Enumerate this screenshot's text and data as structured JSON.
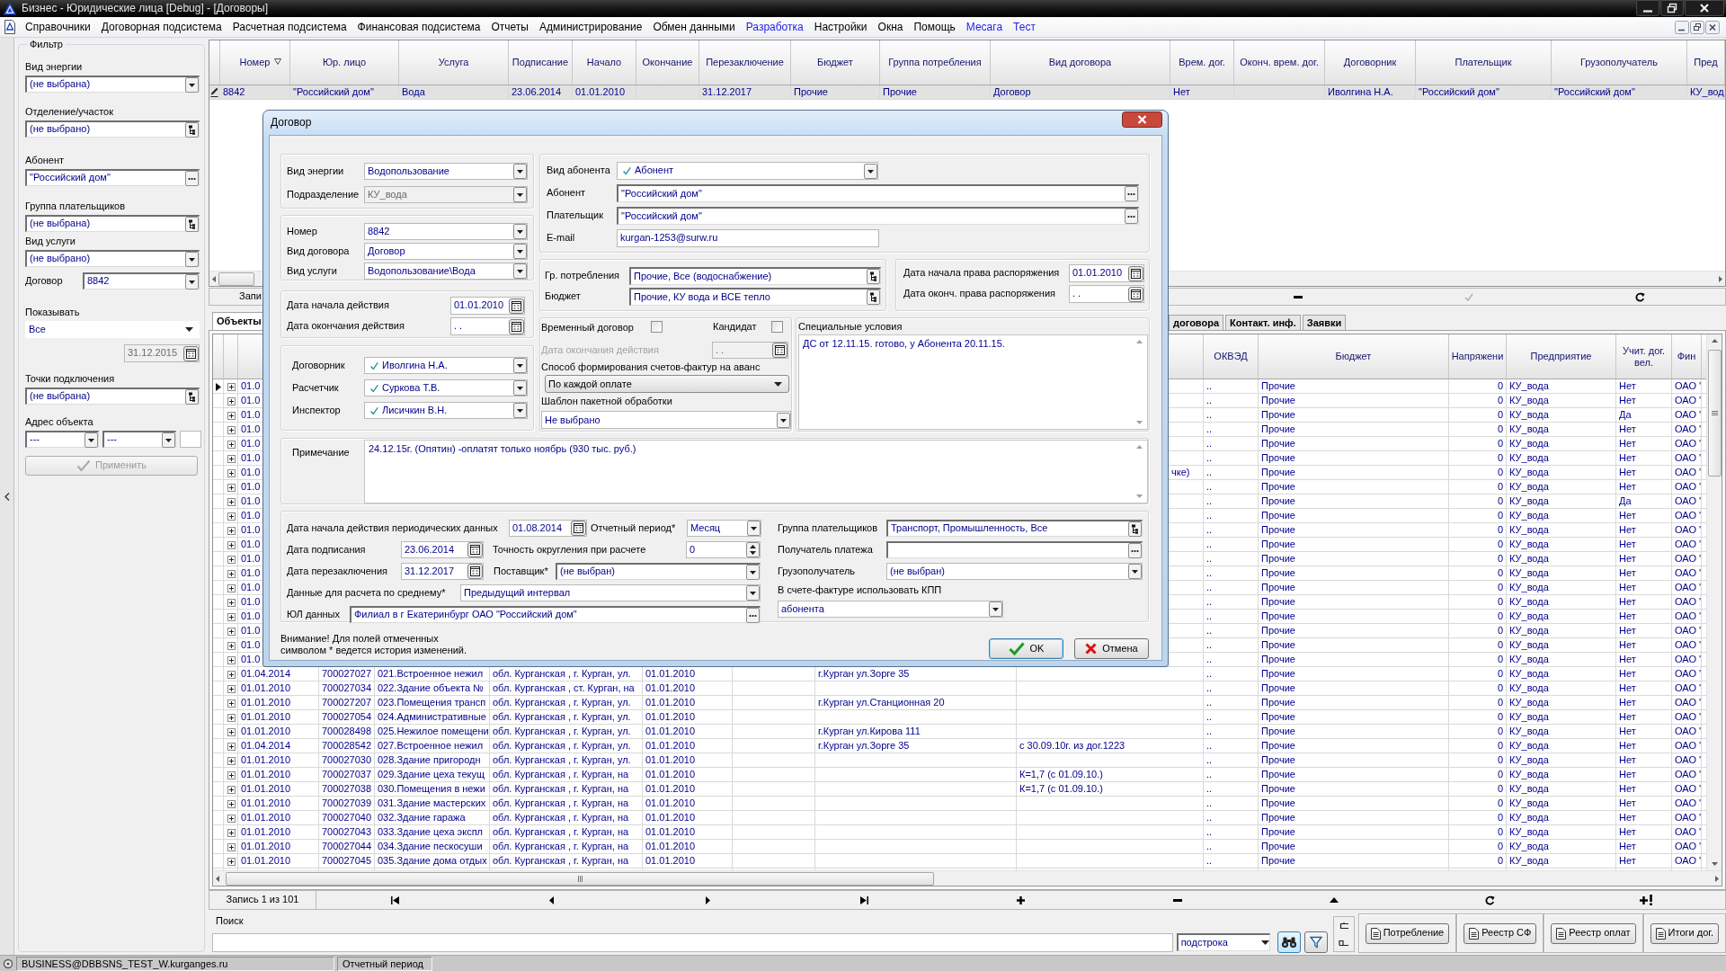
{
  "window": {
    "title": "Бизнес - Юридические лица [Debug] - [Договоры]"
  },
  "menu": [
    {
      "label": "Справочники",
      "color": "#000000"
    },
    {
      "label": "Договорная подсистема",
      "color": "#000000"
    },
    {
      "label": "Расчетная подсистема",
      "color": "#000000"
    },
    {
      "label": "Финансовая подсистема",
      "color": "#000000"
    },
    {
      "label": "Отчеты",
      "color": "#000000"
    },
    {
      "label": "Администрирование",
      "color": "#000000"
    },
    {
      "label": "Обмен данными",
      "color": "#000000"
    },
    {
      "label": "Разработка",
      "color": "#1f1fe6"
    },
    {
      "label": "Настройки",
      "color": "#000000"
    },
    {
      "label": "Окна",
      "color": "#000000"
    },
    {
      "label": "Помощь",
      "color": "#000000"
    },
    {
      "label": "Месага",
      "color": "#1f1fe6"
    },
    {
      "label": "Тест",
      "color": "#1f1fe6"
    }
  ],
  "filter": {
    "title": "Фильтр",
    "fields": [
      {
        "kind": "combo",
        "label": "Вид энергии",
        "value": "(не выбрана)"
      },
      {
        "kind": "tree",
        "label": "Отделение/участок",
        "value": "(не выбрано)"
      },
      {
        "kind": "lookup",
        "label": "Абонент",
        "value": "\"Российский дом\""
      },
      {
        "kind": "tree",
        "label": "Группа плательщиков",
        "value": "(не выбрана)"
      },
      {
        "kind": "combo",
        "label": "Вид услуги",
        "value": "(не выбрано)"
      },
      {
        "kind": "inline_combo",
        "label": "Договор",
        "value": "8842"
      },
      {
        "kind": "flat_combo",
        "label": "Показывать",
        "value": "Все"
      },
      {
        "kind": "date",
        "value": "31.12.2015",
        "disabled": true
      },
      {
        "kind": "tree",
        "label": "Точки подключения",
        "value": "(не выбрана)"
      },
      {
        "kind": "address",
        "label": "Адрес объекта",
        "values": [
          "---",
          "---"
        ]
      }
    ],
    "apply_button": {
      "label": "Применить",
      "disabled": true
    }
  },
  "top_grid": {
    "columns": [
      {
        "label": "Номер",
        "sorted": true
      },
      {
        "label": "Юр. лицо",
        "sorted": false
      },
      {
        "label": "Услуга",
        "sorted": false
      },
      {
        "label": "Подписание",
        "sorted": false
      },
      {
        "label": "Начало",
        "sorted": false
      },
      {
        "label": "Окончание",
        "sorted": false
      },
      {
        "label": "Перезаключение",
        "sorted": false
      },
      {
        "label": "Бюджет",
        "sorted": false
      },
      {
        "label": "Группа потребления",
        "sorted": false
      },
      {
        "label": "Вид договора",
        "sorted": false
      },
      {
        "label": "Врем. дог.",
        "sorted": false
      },
      {
        "label": "Оконч. врем. дог.",
        "sorted": false
      },
      {
        "label": "Договорник",
        "sorted": false
      },
      {
        "label": "Плательщик",
        "sorted": false
      },
      {
        "label": "Грузополучатель",
        "sorted": false
      },
      {
        "label": "Пред",
        "sorted": false
      }
    ],
    "rows": [
      {
        "selected": true,
        "editing": true,
        "cells": {
          "number": "8842",
          "legal_entity": "\"Российский дом\"",
          "service": "Вода",
          "signed": "23.06.2014",
          "start": "01.01.2010",
          "renewal": "31.12.2017",
          "budget": "Прочие",
          "consumption_group": "Прочие",
          "contract_type": "Договор",
          "temporary": "Нет",
          "contractor": "Иволгина Н.А.",
          "payer": "\"Российский дом\"",
          "consignee": "\"Российский дом\"",
          "column_16": "КУ_вод"
        }
      }
    ],
    "navigator": {
      "record": "Запи"
    }
  },
  "tabs": [
    {
      "label": "Объекты",
      "selected": true
    },
    {
      "label": "договора",
      "selected": false
    },
    {
      "label": "Контакт. инф.",
      "selected": false
    },
    {
      "label": "Заявки",
      "selected": false
    }
  ],
  "bottom_grid": {
    "columns": [
      {
        "label": "ОКВЭД"
      },
      {
        "label": "Бюджет"
      },
      {
        "label": "Напряжени"
      },
      {
        "label": "Предприятие"
      },
      {
        "label": "Учит. дог. вел."
      },
      {
        "label": "Фин"
      }
    ],
    "rows": [
      {
        "selected": true,
        "expanded": false,
        "cells": {
          "column_1": "01.0",
          "okved": "..",
          "budget": "Прочие",
          "voltage": "0",
          "enterprise": "КУ_вода",
          "accounted": "Нет",
          "fin": "ОАО '"
        }
      },
      {
        "selected": false,
        "expanded": false,
        "cells": {
          "column_1": "01.0",
          "okved": "..",
          "budget": "Прочие",
          "voltage": "0",
          "enterprise": "КУ_вода",
          "accounted": "Нет",
          "fin": "ОАО '"
        }
      },
      {
        "selected": false,
        "expanded": false,
        "cells": {
          "column_1": "01.0",
          "okved": "..",
          "budget": "Прочие",
          "voltage": "0",
          "enterprise": "КУ_вода",
          "accounted": "Да",
          "fin": "ОАО '"
        }
      },
      {
        "selected": false,
        "expanded": false,
        "cells": {
          "column_1": "01.0",
          "okved": "..",
          "budget": "Прочие",
          "voltage": "0",
          "enterprise": "КУ_вода",
          "accounted": "Нет",
          "fin": "ОАО '"
        }
      },
      {
        "selected": false,
        "expanded": false,
        "cells": {
          "column_1": "01.0",
          "okved": "..",
          "budget": "Прочие",
          "voltage": "0",
          "enterprise": "КУ_вода",
          "accounted": "Нет",
          "fin": "ОАО '"
        }
      },
      {
        "selected": false,
        "expanded": false,
        "cells": {
          "column_1": "01.0",
          "okved": "..",
          "budget": "Прочие",
          "voltage": "0",
          "enterprise": "КУ_вода",
          "accounted": "Нет",
          "fin": "ОАО '"
        }
      },
      {
        "selected": false,
        "expanded": false,
        "cells": {
          "column_1": "01.0",
          "column_8": "чке)",
          "okved": "..",
          "budget": "Прочие",
          "voltage": "0",
          "enterprise": "КУ_вода",
          "accounted": "Нет",
          "fin": "ОАО '"
        }
      },
      {
        "selected": false,
        "expanded": false,
        "cells": {
          "column_1": "01.0",
          "okved": "..",
          "budget": "Прочие",
          "voltage": "0",
          "enterprise": "КУ_вода",
          "accounted": "Нет",
          "fin": "ОАО '"
        }
      },
      {
        "selected": false,
        "expanded": false,
        "cells": {
          "column_1": "01.0",
          "okved": "..",
          "budget": "Прочие",
          "voltage": "0",
          "enterprise": "КУ_вода",
          "accounted": "Да",
          "fin": "ОАО '"
        }
      },
      {
        "selected": false,
        "expanded": false,
        "cells": {
          "column_1": "01.0",
          "okved": "..",
          "budget": "Прочие",
          "voltage": "0",
          "enterprise": "КУ_вода",
          "accounted": "Нет",
          "fin": "ОАО '"
        }
      },
      {
        "selected": false,
        "expanded": false,
        "cells": {
          "column_1": "01.0",
          "okved": "..",
          "budget": "Прочие",
          "voltage": "0",
          "enterprise": "КУ_вода",
          "accounted": "Нет",
          "fin": "ОАО '"
        }
      },
      {
        "selected": false,
        "expanded": false,
        "cells": {
          "column_1": "01.0",
          "okved": "..",
          "budget": "Прочие",
          "voltage": "0",
          "enterprise": "КУ_вода",
          "accounted": "Нет",
          "fin": "ОАО '"
        }
      },
      {
        "selected": false,
        "expanded": false,
        "cells": {
          "column_1": "01.0",
          "okved": "..",
          "budget": "Прочие",
          "voltage": "0",
          "enterprise": "КУ_вода",
          "accounted": "Нет",
          "fin": "ОАО '"
        }
      },
      {
        "selected": false,
        "expanded": false,
        "cells": {
          "column_1": "01.0",
          "okved": "..",
          "budget": "Прочие",
          "voltage": "0",
          "enterprise": "КУ_вода",
          "accounted": "Нет",
          "fin": "ОАО '"
        }
      },
      {
        "selected": false,
        "expanded": false,
        "cells": {
          "column_1": "01.0",
          "okved": "..",
          "budget": "Прочие",
          "voltage": "0",
          "enterprise": "КУ_вода",
          "accounted": "Нет",
          "fin": "ОАО '"
        }
      },
      {
        "selected": false,
        "expanded": false,
        "cells": {
          "column_1": "01.0",
          "okved": "..",
          "budget": "Прочие",
          "voltage": "0",
          "enterprise": "КУ_вода",
          "accounted": "Нет",
          "fin": "ОАО '"
        }
      },
      {
        "selected": false,
        "expanded": false,
        "cells": {
          "column_1": "01.0",
          "okved": "..",
          "budget": "Прочие",
          "voltage": "0",
          "enterprise": "КУ_вода",
          "accounted": "Нет",
          "fin": "ОАО '"
        }
      },
      {
        "selected": false,
        "expanded": false,
        "cells": {
          "column_1": "01.0",
          "okved": "..",
          "budget": "Прочие",
          "voltage": "0",
          "enterprise": "КУ_вода",
          "accounted": "Нет",
          "fin": "ОАО '"
        }
      },
      {
        "selected": false,
        "expanded": false,
        "cells": {
          "column_1": "01.0",
          "okved": "..",
          "budget": "Прочие",
          "voltage": "0",
          "enterprise": "КУ_вода",
          "accounted": "Нет",
          "fin": "ОАО '"
        }
      },
      {
        "selected": false,
        "expanded": false,
        "cells": {
          "column_1": "01.0",
          "okved": "..",
          "budget": "Прочие",
          "voltage": "0",
          "enterprise": "КУ_вода",
          "accounted": "Нет",
          "fin": "ОАО '"
        }
      },
      {
        "selected": false,
        "expanded": false,
        "cells": {
          "column_1": "01.04.2014",
          "column_2": "700027027",
          "column_3": "021.Встроенное нежил",
          "column_4": "обл. Курганская , г. Курган, ул.",
          "column_5": "01.01.2010",
          "column_7": "г.Курган ул.Зорге 35",
          "okved": "..",
          "budget": "Прочие",
          "voltage": "0",
          "enterprise": "КУ_вода",
          "accounted": "Нет",
          "fin": "ОАО '"
        }
      },
      {
        "selected": false,
        "expanded": false,
        "cells": {
          "column_1": "01.01.2010",
          "column_2": "700027034",
          "column_3": "022.Здание объекта №",
          "column_4": "обл. Курганская , ст. Курган, на",
          "column_5": "01.01.2010",
          "okved": "..",
          "budget": "Прочие",
          "voltage": "0",
          "enterprise": "КУ_вода",
          "accounted": "Нет",
          "fin": "ОАО '"
        }
      },
      {
        "selected": false,
        "expanded": false,
        "cells": {
          "column_1": "01.01.2010",
          "column_2": "700027207",
          "column_3": "023.Помещения трансп",
          "column_4": "обл. Курганская , г. Курган, ул.",
          "column_5": "01.01.2010",
          "column_7": "г.Курган ул.Станционная 20",
          "okved": "..",
          "budget": "Прочие",
          "voltage": "0",
          "enterprise": "КУ_вода",
          "accounted": "Нет",
          "fin": "ОАО '"
        }
      },
      {
        "selected": false,
        "expanded": false,
        "cells": {
          "column_1": "01.01.2010",
          "column_2": "700027054",
          "column_3": "024.Административные",
          "column_4": "обл. Курганская , г. Курган, ул.",
          "column_5": "01.01.2010",
          "okved": "..",
          "budget": "Прочие",
          "voltage": "0",
          "enterprise": "КУ_вода",
          "accounted": "Нет",
          "fin": "ОАО '"
        }
      },
      {
        "selected": false,
        "expanded": false,
        "cells": {
          "column_1": "01.01.2010",
          "column_2": "700028498",
          "column_3": "025.Нежилое помещени",
          "column_4": "обл. Курганская , г. Курган, ул.",
          "column_5": "01.01.2010",
          "column_7": "г.Курган ул.Кирова 111",
          "okved": "..",
          "budget": "Прочие",
          "voltage": "0",
          "enterprise": "КУ_вода",
          "accounted": "Нет",
          "fin": "ОАО '"
        }
      },
      {
        "selected": false,
        "expanded": false,
        "cells": {
          "column_1": "01.04.2014",
          "column_2": "700028542",
          "column_3": "027.Встроенное нежил",
          "column_4": "обл. Курганская , г. Курган, ул.",
          "column_5": "01.01.2010",
          "column_7": "г.Курган ул.Зорге 35",
          "column_8": "с 30.09.10г. из дог.1223",
          "okved": "..",
          "budget": "Прочие",
          "voltage": "0",
          "enterprise": "КУ_вода",
          "accounted": "Нет",
          "fin": "ОАО '"
        }
      },
      {
        "selected": false,
        "expanded": false,
        "cells": {
          "column_1": "01.01.2010",
          "column_2": "700027030",
          "column_3": "028.Здание пригородн",
          "column_4": "обл. Курганская , г. Курган, ул.",
          "column_5": "01.01.2010",
          "okved": "..",
          "budget": "Прочие",
          "voltage": "0",
          "enterprise": "КУ_вода",
          "accounted": "Нет",
          "fin": "ОАО '"
        }
      },
      {
        "selected": false,
        "expanded": false,
        "cells": {
          "column_1": "01.01.2010",
          "column_2": "700027037",
          "column_3": "029.Здание цеха текущ",
          "column_4": "обл. Курганская , г. Курган, на",
          "column_5": "01.01.2010",
          "column_8": "К=1,7 (с 01.09.10.)",
          "okved": "..",
          "budget": "Прочие",
          "voltage": "0",
          "enterprise": "КУ_вода",
          "accounted": "Нет",
          "fin": "ОАО '"
        }
      },
      {
        "selected": false,
        "expanded": false,
        "cells": {
          "column_1": "01.01.2010",
          "column_2": "700027038",
          "column_3": "030.Помещения в нежи",
          "column_4": "обл. Курганская , г. Курган, на",
          "column_5": "01.01.2010",
          "column_8": "К=1,7 (с 01.09.10.)",
          "okved": "..",
          "budget": "Прочие",
          "voltage": "0",
          "enterprise": "КУ_вода",
          "accounted": "Нет",
          "fin": "ОАО '"
        }
      },
      {
        "selected": false,
        "expanded": false,
        "cells": {
          "column_1": "01.01.2010",
          "column_2": "700027039",
          "column_3": "031.Здание мастерских",
          "column_4": "обл. Курганская , г. Курган, на",
          "column_5": "01.01.2010",
          "okved": "..",
          "budget": "Прочие",
          "voltage": "0",
          "enterprise": "КУ_вода",
          "accounted": "Нет",
          "fin": "ОАО '"
        }
      },
      {
        "selected": false,
        "expanded": false,
        "cells": {
          "column_1": "01.01.2010",
          "column_2": "700027040",
          "column_3": "032.Здание гаража",
          "column_4": "обл. Курганская , г. Курган, на",
          "column_5": "01.01.2010",
          "okved": "..",
          "budget": "Прочие",
          "voltage": "0",
          "enterprise": "КУ_вода",
          "accounted": "Нет",
          "fin": "ОАО '"
        }
      },
      {
        "selected": false,
        "expanded": false,
        "cells": {
          "column_1": "01.01.2010",
          "column_2": "700027043",
          "column_3": "033.Здание цеха экспл",
          "column_4": "обл. Курганская , г. Курган, на",
          "column_5": "01.01.2010",
          "okved": "..",
          "budget": "Прочие",
          "voltage": "0",
          "enterprise": "КУ_вода",
          "accounted": "Нет",
          "fin": "ОАО '"
        }
      },
      {
        "selected": false,
        "expanded": false,
        "cells": {
          "column_1": "01.01.2010",
          "column_2": "700027044",
          "column_3": "034.Здание пескосуши",
          "column_4": "обл. Курганская , г. Курган, на",
          "column_5": "01.01.2010",
          "okved": "..",
          "budget": "Прочие",
          "voltage": "0",
          "enterprise": "КУ_вода",
          "accounted": "Нет",
          "fin": "ОАО '"
        }
      },
      {
        "selected": false,
        "expanded": false,
        "cells": {
          "column_1": "01.01.2010",
          "column_2": "700027045",
          "column_3": "035.Здание дома отдых",
          "column_4": "обл. Курганская , г. Курган, на",
          "column_5": "01.01.2010",
          "okved": "..",
          "budget": "Прочие",
          "voltage": "0",
          "enterprise": "КУ_вода",
          "accounted": "Нет",
          "fin": "ОАО '"
        }
      }
    ],
    "navigator": {
      "record": "Запись 1 из 101"
    }
  },
  "search": {
    "label": "Поиск",
    "mode": "подстрока"
  },
  "actions": [
    {
      "label": "Потребление"
    },
    {
      "label": "Реестр СФ"
    },
    {
      "label": "Реестр оплат"
    },
    {
      "label": "Итоги дог."
    }
  ],
  "dialog": {
    "title": "Договор",
    "energy_type": {
      "label": "Вид энергии",
      "value": "Водопользование"
    },
    "division": {
      "label": "Подразделение",
      "value": "КУ_вода",
      "disabled": true
    },
    "number": {
      "label": "Номер",
      "value": "8842"
    },
    "contract_type": {
      "label": "Вид договора",
      "value": "Договор"
    },
    "service_type": {
      "label": "Вид услуги",
      "value": "Водопользование\\Вода"
    },
    "start_date": {
      "label": "Дата начала действия",
      "value": "01.01.2010"
    },
    "end_date": {
      "label": "Дата окончания действия",
      "value": ". ."
    },
    "people": [
      {
        "label": "Договорник",
        "value": "Иволгина Н.А.",
        "checked": true
      },
      {
        "label": "Расчетчик",
        "value": "Суркова Т.В.",
        "checked": true
      },
      {
        "label": "Инспектор",
        "value": "Лисичкин В.Н.",
        "checked": true
      }
    ],
    "subscriber_type": {
      "label": "Вид абонента",
      "value": "Абонент",
      "checked": true
    },
    "subscriber": {
      "label": "Абонент",
      "value": "\"Российский дом\""
    },
    "payer": {
      "label": "Плательщик",
      "value": "\"Российский дом\""
    },
    "email": {
      "label": "E-mail",
      "value": "kurgan-1253@surw.ru"
    },
    "consumption_group": {
      "label": "Гр. потребления",
      "value": "Прочие, Все (водоснабжение)"
    },
    "budget": {
      "label": "Бюджет",
      "value": "Прочие, КУ вода и ВСЕ тепло"
    },
    "disposal_start": {
      "label": "Дата начала права распоряжения",
      "value": "01.01.2010"
    },
    "disposal_end": {
      "label": "Дата оконч. права распоряжения",
      "value": ". ."
    },
    "temporary": {
      "label": "Временный договор",
      "checked": false
    },
    "candidate": {
      "label": "Кандидат",
      "checked": false
    },
    "temp_end_date": {
      "label": "Дата окончания действия",
      "value": ". .",
      "disabled": true
    },
    "invoice_method": {
      "label": "Способ формирования счетов-фактур на аванс",
      "value": "По каждой оплате"
    },
    "batch_template": {
      "label": "Шаблон пакетной обработки",
      "value": "Не выбрано"
    },
    "special_conditions": {
      "label": "Специальные условия",
      "value": "ДС от 12.11.15. готово, у Абонента 20.11.15."
    },
    "note": {
      "label": "Примечание",
      "value": "24.12.15г. (Опятин) -оплатят только ноябрь (930 тыс. руб.)"
    },
    "periodic_start": {
      "label": "Дата начала действия периодических данных",
      "value": "01.08.2014"
    },
    "report_period": {
      "label": "Отчетный период*",
      "value": "Месяц"
    },
    "signed": {
      "label": "Дата подписания",
      "value": "23.06.2014"
    },
    "rounding": {
      "label": "Точность округления при расчете",
      "value": "0"
    },
    "renewal": {
      "label": "Дата перезаключения",
      "value": "31.12.2017"
    },
    "supplier": {
      "label": "Поставщик*",
      "value": "(не выбран)"
    },
    "average_data": {
      "label": "Данные для расчета по среднему*",
      "value": "Предыдущий интервал"
    },
    "legal_data": {
      "label": "ЮЛ данных",
      "value": "Филиал в г Екатеринбург ОАО \"Российский дом\""
    },
    "payer_group": {
      "label": "Группа плательщиков",
      "value": "Транспорт, Промышленность, Все"
    },
    "recipient": {
      "label": "Получатель платежа"
    },
    "consignee": {
      "label": "Грузополучатель",
      "value": "(не выбран)"
    },
    "kpp": {
      "label": "В счете-фактуре использовать КПП",
      "value": "абонента"
    },
    "notice": [
      "Внимание! Для полей отмеченных",
      "символом * ведется история изменений."
    ],
    "buttons": [
      {
        "kind": "ok",
        "label": "OK",
        "default": true
      },
      {
        "kind": "cancel",
        "label": "Отмена",
        "default": false
      }
    ]
  },
  "status_bar": [
    {
      "text": "BUSINESS@DBBSNS_TEST_W.kurganges.ru"
    },
    {
      "text": "Отчетный период"
    }
  ]
}
